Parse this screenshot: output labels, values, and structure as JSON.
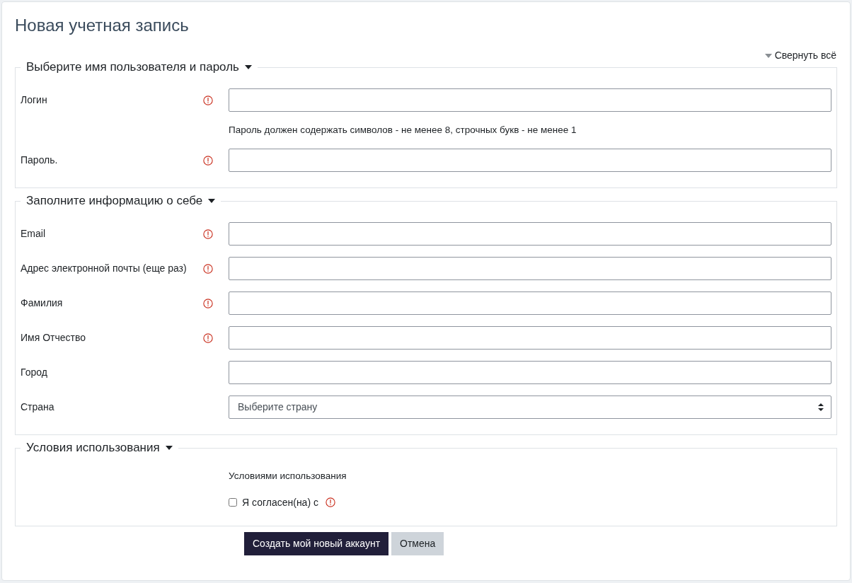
{
  "title": "Новая учетная запись",
  "collapse_all": "Свернуть всё",
  "sections": [
    {
      "legend": "Выберите имя пользователя и пароль",
      "expanded": true,
      "rows": [
        {
          "kind": "input",
          "label": "Логин",
          "required": true
        },
        {
          "kind": "note",
          "text": "Пароль должен содержать символов - не менее 8, строчных букв - не менее 1"
        },
        {
          "kind": "input",
          "label": "Пароль.",
          "required": true
        }
      ]
    },
    {
      "legend": "Заполните информацию о себе",
      "expanded": true,
      "rows": [
        {
          "kind": "input",
          "label": "Email",
          "required": true
        },
        {
          "kind": "input",
          "label": "Адрес электронной почты (еще раз)",
          "required": true
        },
        {
          "kind": "input",
          "label": "Фамилия",
          "required": true
        },
        {
          "kind": "input",
          "label": "Имя Отчество",
          "required": true
        },
        {
          "kind": "input",
          "label": "Город",
          "required": false
        },
        {
          "kind": "select",
          "label": "Страна",
          "value": "Выберите страну"
        }
      ]
    },
    {
      "legend": "Условия использования",
      "expanded": true,
      "rows": [
        {
          "kind": "note",
          "text": "Условиями использования"
        },
        {
          "kind": "checkbox",
          "label": "Я согласен(на) с",
          "checked": false,
          "required": true
        }
      ]
    }
  ],
  "buttons": [
    {
      "label": "Создать мой новый аккаунт",
      "primary": true
    },
    {
      "label": "Отмена",
      "primary": false
    }
  ]
}
